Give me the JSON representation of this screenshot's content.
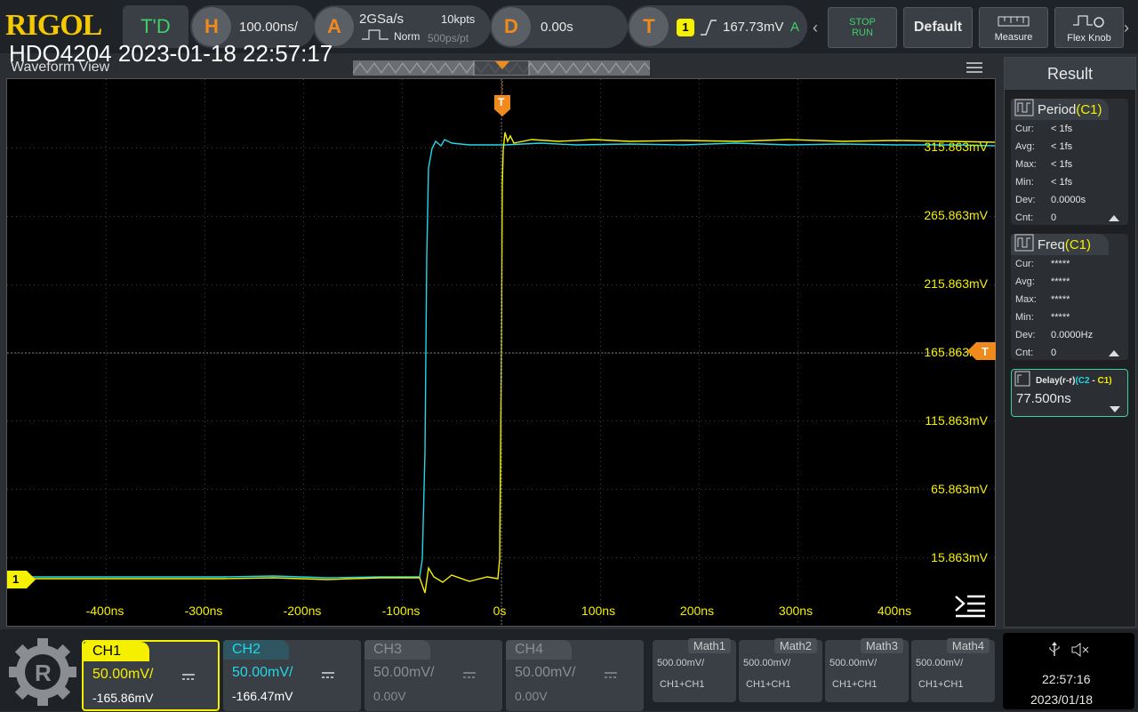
{
  "brand": "RIGOL",
  "title_overlay": "HDO4204 2023-01-18 22:57:17",
  "waveform_view_label": "Waveform View",
  "top": {
    "mode": "T'D",
    "h_letter": "H",
    "timebase": "100.00ns/",
    "a_letter": "A",
    "sample_rate": "2GSa/s",
    "memory": "10kpts",
    "acq_mode": "Norm",
    "sample_period": "500ps/pt",
    "d_letter": "D",
    "delay": "0.00s",
    "t_letter": "T",
    "trig_source": "1",
    "trig_level": "167.73mV",
    "trig_status": "A",
    "stop_label": "STOP",
    "run_label": "RUN",
    "default_label": "Default",
    "measure_label": "Measure",
    "flexknob_label": "Flex Knob"
  },
  "waveform": {
    "y_labels": [
      "315.863mV",
      "265.863mV",
      "215.863mV",
      "165.863mV",
      "115.863mV",
      "65.863mV",
      "15.863mV"
    ],
    "x_labels": [
      "-400ns",
      "-300ns",
      "-200ns",
      "-100ns",
      "0s",
      "100ns",
      "200ns",
      "300ns",
      "400ns"
    ],
    "trigger_marker": "T",
    "ch1_marker": "1"
  },
  "result": {
    "title": "Result",
    "period": {
      "name": "Period",
      "src": "(C1)",
      "rows": [
        [
          "Cur:",
          "< 1fs"
        ],
        [
          "Avg:",
          "< 1fs"
        ],
        [
          "Max:",
          "< 1fs"
        ],
        [
          "Min:",
          "< 1fs"
        ],
        [
          "Dev:",
          "0.0000s"
        ],
        [
          "Cnt:",
          "0"
        ]
      ]
    },
    "freq": {
      "name": "Freq",
      "src": "(C1)",
      "rows": [
        [
          "Cur:",
          "*****"
        ],
        [
          "Avg:",
          "*****"
        ],
        [
          "Max:",
          "*****"
        ],
        [
          "Min:",
          "*****"
        ],
        [
          "Dev:",
          "0.0000Hz"
        ],
        [
          "Cnt:",
          "0"
        ]
      ]
    },
    "delay": {
      "name": "Delay(r-r)",
      "src_a": "(C2",
      "dash": " - ",
      "src_b": "C1)",
      "value": "77.500ns"
    }
  },
  "channels": [
    {
      "name": "CH1",
      "scale": "50.00mV/",
      "offset": "-165.86mV",
      "color": "#f5f000"
    },
    {
      "name": "CH2",
      "scale": "50.00mV/",
      "offset": "-166.47mV",
      "color": "#20d8e8"
    },
    {
      "name": "CH3",
      "scale": "50.00mV/",
      "offset": "0.00V",
      "color": "#8a8d92"
    },
    {
      "name": "CH4",
      "scale": "50.00mV/",
      "offset": "0.00V",
      "color": "#8a8d92"
    }
  ],
  "maths": [
    {
      "name": "Math1",
      "scale": "500.00mV/",
      "expr": "CH1+CH1"
    },
    {
      "name": "Math2",
      "scale": "500.00mV/",
      "expr": "CH1+CH1"
    },
    {
      "name": "Math3",
      "scale": "500.00mV/",
      "expr": "CH1+CH1"
    },
    {
      "name": "Math4",
      "scale": "500.00mV/",
      "expr": "CH1+CH1"
    }
  ],
  "clock": {
    "time": "22:57:16",
    "date": "2023/01/18"
  },
  "colors": {
    "ch1": "#f5f000",
    "ch2": "#20d8e8",
    "accent": "#f08a1c"
  }
}
